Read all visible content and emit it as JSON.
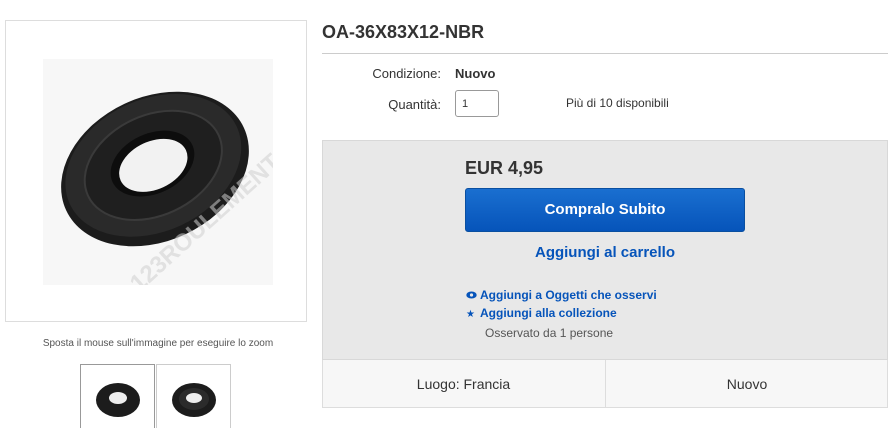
{
  "gallery": {
    "zoom_hint": "Sposta il mouse sull'immagine per eseguire lo zoom",
    "watermark": "123ROULEMENT",
    "thumbnail_count": 2
  },
  "product": {
    "title": "OA-36X83X12-NBR",
    "condition_label": "Condizione:",
    "condition_value": "Nuovo",
    "quantity_label": "Quantità:",
    "quantity_value": "1",
    "availability": "Più di 10 disponibili"
  },
  "buy_box": {
    "price": "EUR 4,95",
    "buy_now_label": "Compralo Subito",
    "add_to_cart_label": "Aggiungi al carrello",
    "watch_label": "Aggiungi a Oggetti che osservi",
    "watch_icon": "eye-icon",
    "collection_label": "Aggiungi alla collezione",
    "collection_icon": "star-icon",
    "watchers_text": "Osservato da 1 persone"
  },
  "footer_strip": {
    "location": "Luogo: Francia",
    "condition": "Nuovo"
  },
  "colors": {
    "link_blue": "#0654ba",
    "button_blue": "#0654ba",
    "box_gray": "#e8e8e8"
  }
}
